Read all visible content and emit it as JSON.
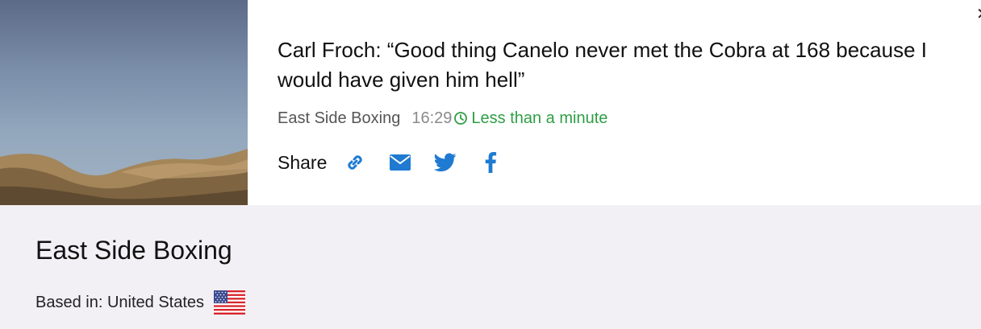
{
  "article": {
    "title": "Carl Froch: “Good thing Canelo never met the Cobra at 168 because I would have given him hell”",
    "source": "East Side Boxing",
    "time": "16:29",
    "read_time": "Less than a minute"
  },
  "share": {
    "label": "Share",
    "icons": [
      "link-icon",
      "email-icon",
      "twitter-icon",
      "facebook-icon"
    ]
  },
  "profile": {
    "name": "East Side Boxing",
    "based_in_label": "Based in: United States",
    "country_flag": "us-flag-icon"
  },
  "colors": {
    "accent_blue": "#1f7ad1",
    "read_time_green": "#2e9e45",
    "band_background": "#f2f0f5"
  }
}
